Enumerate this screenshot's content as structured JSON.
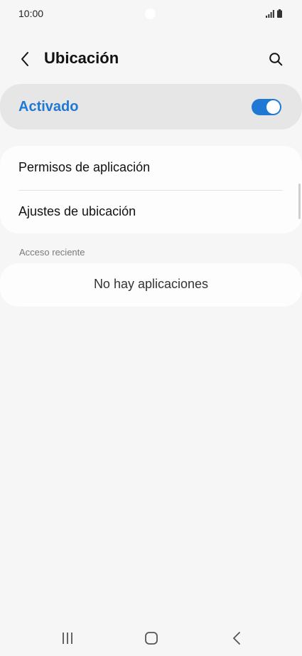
{
  "status_bar": {
    "time": "10:00",
    "icons": [
      "signal-icon",
      "battery-icon"
    ]
  },
  "app_bar": {
    "title": "Ubicación",
    "back_icon": "chevron-left-icon",
    "search_icon": "search-icon"
  },
  "master_switch": {
    "label": "Activado",
    "state": "on",
    "accent_color": "#1f78d4"
  },
  "settings": {
    "items": [
      {
        "label": "Permisos de aplicación"
      },
      {
        "label": "Ajustes de ubicación"
      }
    ]
  },
  "recent_access": {
    "header": "Acceso reciente",
    "empty_text": "No hay aplicaciones"
  },
  "nav_bar": {
    "icons": [
      "recents-icon",
      "home-icon",
      "back-icon"
    ]
  }
}
